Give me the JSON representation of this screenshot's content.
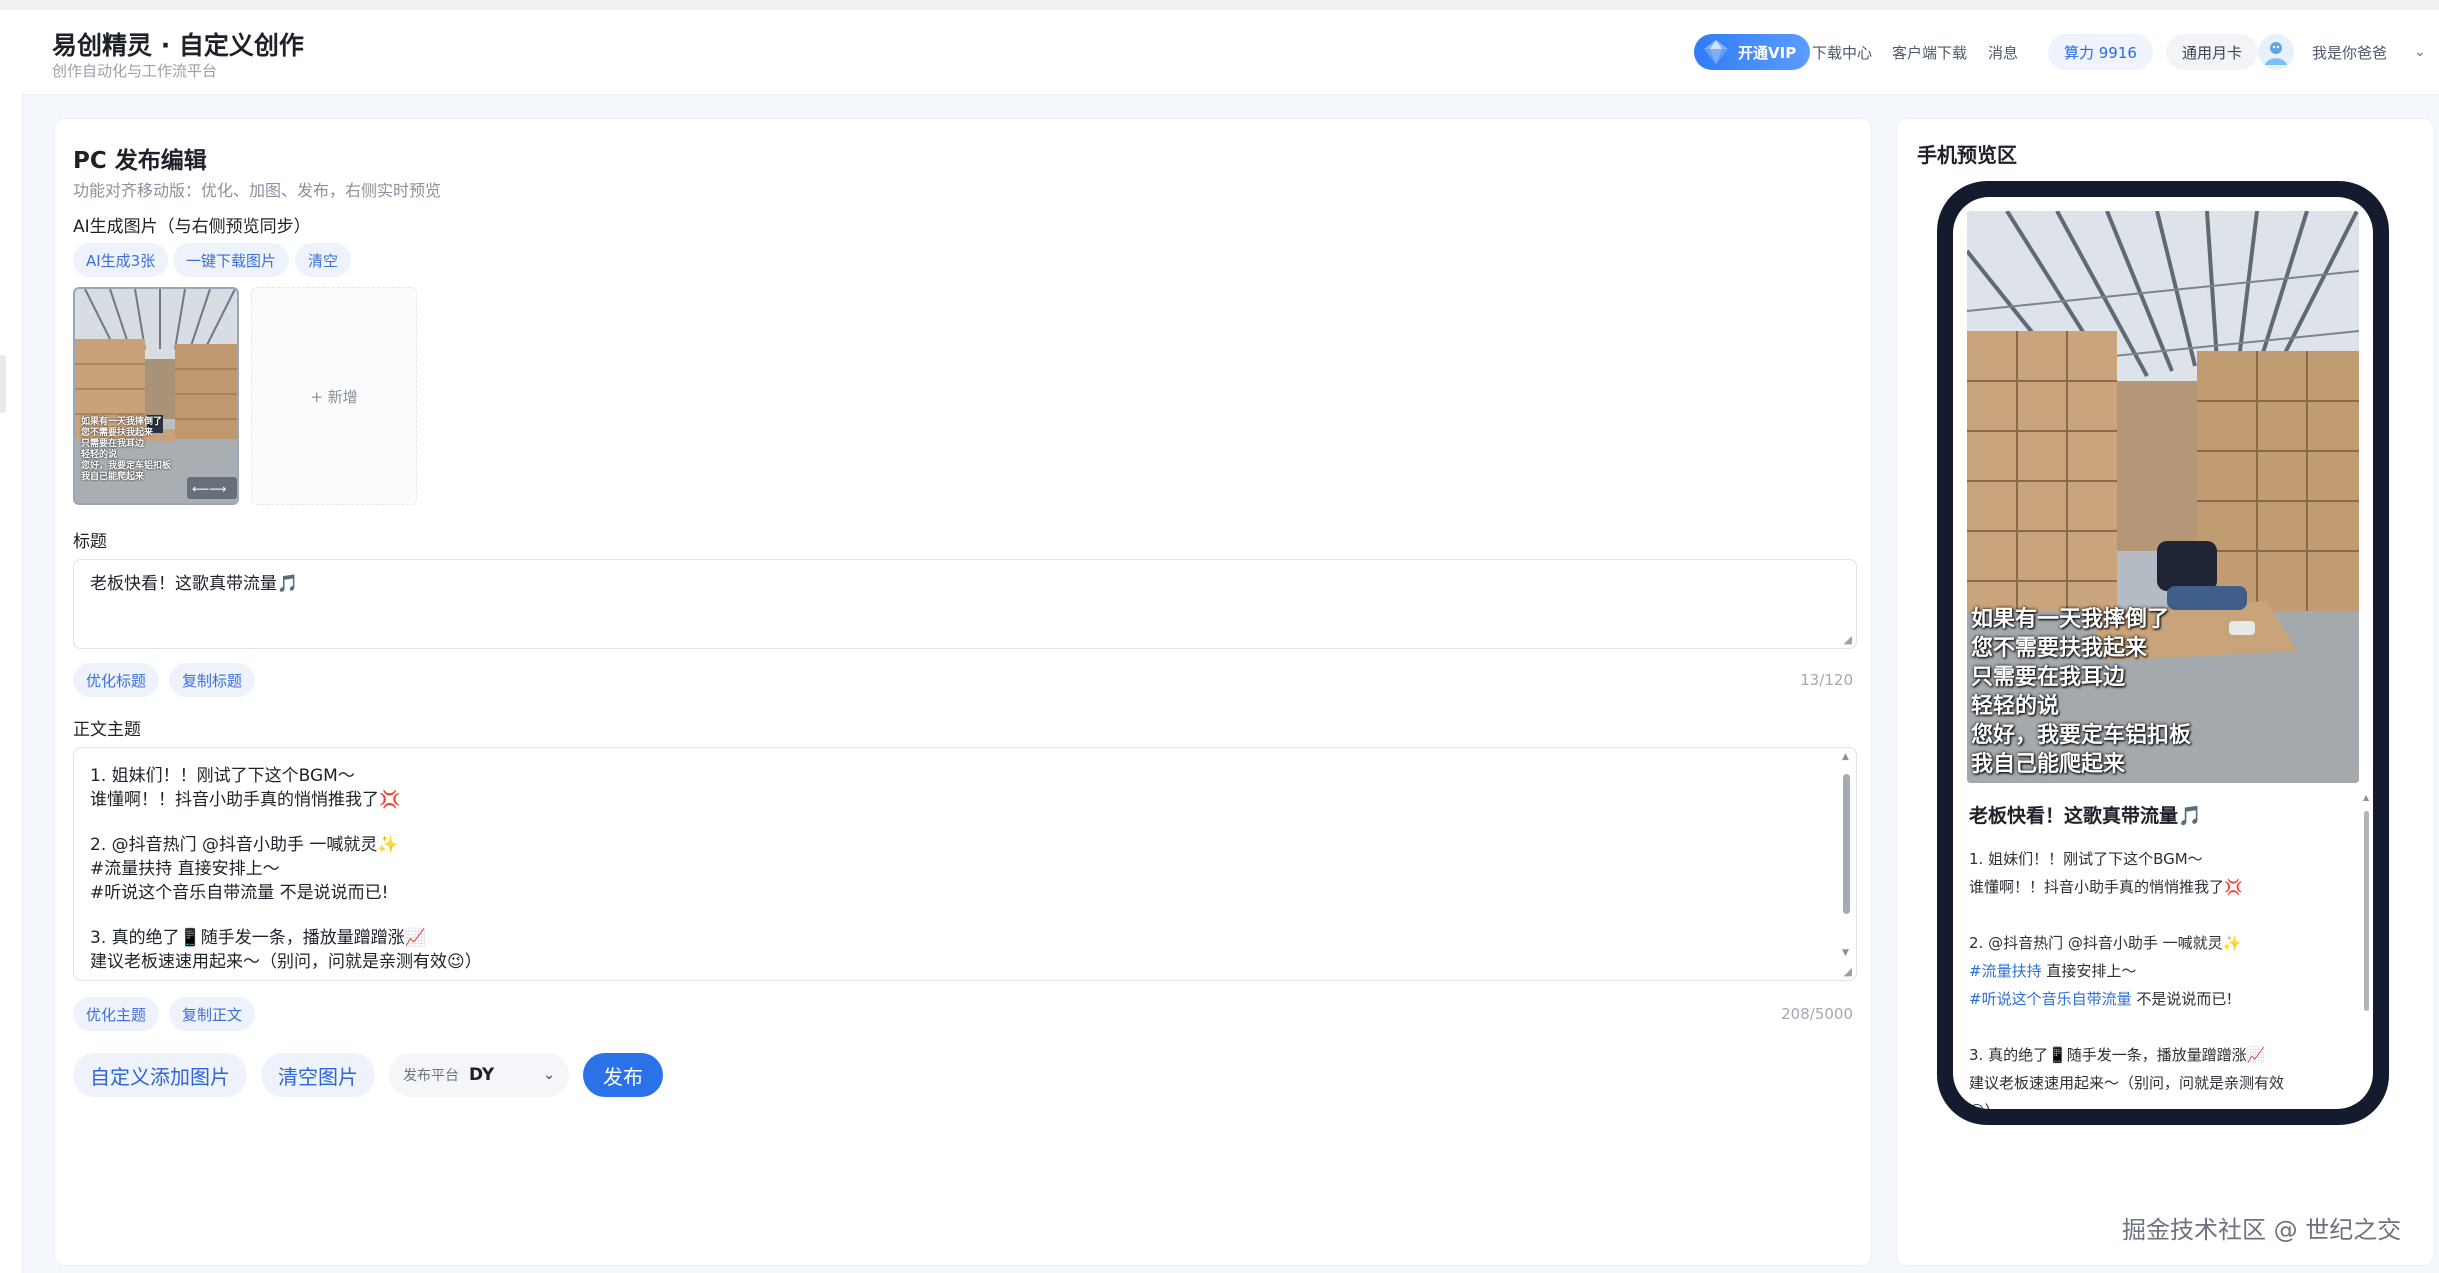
{
  "app": {
    "title": "易创精灵 · 自定义创作",
    "subtitle": "创作自动化与工作流平台"
  },
  "header_nav": {
    "vip": "开通VIP",
    "download_center": "下载中心",
    "client_download": "客户端下载",
    "messages": "消息",
    "compute": "算力 9916",
    "monthly_card": "通用月卡",
    "username": "我是你爸爸"
  },
  "editor": {
    "title": "PC 发布编辑",
    "hint": "功能对齐移动版：优化、加图、发布，右侧实时预览",
    "images_label": "AI生成图片（与右侧预览同步）",
    "image_actions": [
      "AI生成3张",
      "一键下载图片",
      "清空"
    ],
    "add_tile": "+ 新增",
    "thumb_caption": [
      "如果有一天我摔倒了",
      "您不需要扶我起来",
      "只需要在我耳边",
      "轻轻的说",
      "您好，我要定车铝扣板",
      "我自己能爬起来"
    ],
    "title_label": "标题",
    "title_value": "老板快看！这歌真带流量🎵",
    "title_actions": [
      "优化标题",
      "复制标题"
    ],
    "title_counter": "13/120",
    "body_label": "正文主题",
    "body_lines": [
      "1. 姐妹们！！刚试了下这个BGM～",
      "谁懂啊！！抖音小助手真的悄悄推我了💢",
      "",
      "2. @抖音热门 @抖音小助手 一喊就灵✨",
      "#流量扶持 直接安排上～",
      "#听说这个音乐自带流量 不是说说而已!",
      "",
      "3. 真的绝了📱随手发一条，播放量蹭蹭涨📈",
      "建议老板速速用起来～（别问，问就是亲测有效😉）"
    ],
    "body_actions": [
      "优化主题",
      "复制正文"
    ],
    "body_counter": "208/5000",
    "custom_add_image": "自定义添加图片",
    "clear_images": "清空图片",
    "platform_label": "发布平台",
    "platform_value": "DY",
    "publish": "发布"
  },
  "preview": {
    "title": "手机预览区",
    "post_title": "老板快看！这歌真带流量🎵",
    "caption": [
      "如果有一天我摔倒了",
      "您不需要扶我起来",
      "只需要在我耳边",
      "轻轻的说",
      "您好，我要定车铝扣板",
      "我自己能爬起来"
    ],
    "body": {
      "l1": "1. 姐妹们！！刚试了下这个BGM～",
      "l2": "谁懂啊！！抖音小助手真的悄悄推我了💢",
      "l3": "2. @抖音热门 @抖音小助手 一喊就灵✨",
      "l4_tag": "#流量扶持",
      "l4_rest": "直接安排上～",
      "l5_tag": "#听说这个音乐自带流量",
      "l5_rest": "不是说说而已!",
      "l6": "3. 真的绝了📱随手发一条，播放量蹭蹭涨📈",
      "l7": "建议老板速速用起来～（别问，问就是亲测有效",
      "l8": "😉）"
    }
  },
  "watermark": "掘金技术社区 @ 世纪之交",
  "colors": {
    "accent": "#2b72e8",
    "chip_bg": "#eef3fb",
    "phone_frame": "#151b2e",
    "tag": "#2e6fd8"
  }
}
